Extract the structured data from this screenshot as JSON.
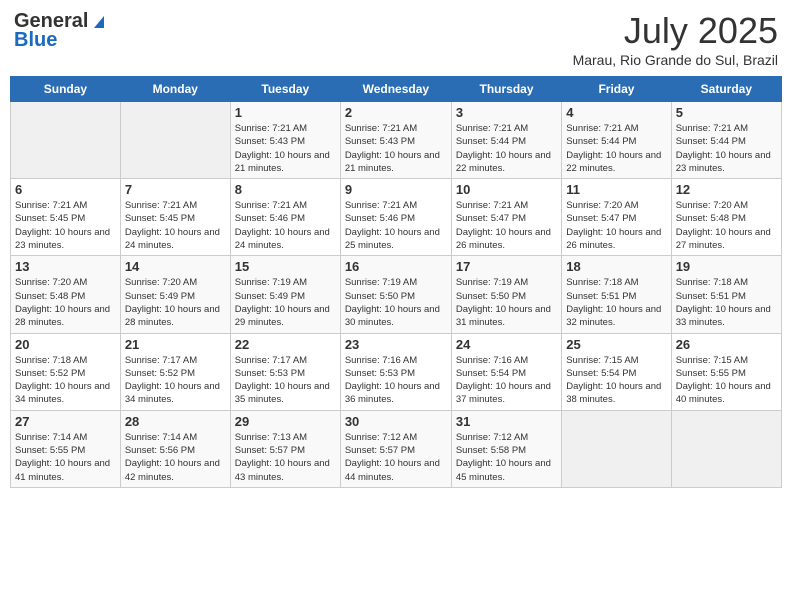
{
  "header": {
    "logo_general": "General",
    "logo_blue": "Blue",
    "title": "July 2025",
    "location": "Marau, Rio Grande do Sul, Brazil"
  },
  "days_of_week": [
    "Sunday",
    "Monday",
    "Tuesday",
    "Wednesday",
    "Thursday",
    "Friday",
    "Saturday"
  ],
  "weeks": [
    [
      {
        "day": "",
        "empty": true
      },
      {
        "day": "",
        "empty": true
      },
      {
        "day": "1",
        "sunrise": "7:21 AM",
        "sunset": "5:43 PM",
        "daylight": "10 hours and 21 minutes."
      },
      {
        "day": "2",
        "sunrise": "7:21 AM",
        "sunset": "5:43 PM",
        "daylight": "10 hours and 21 minutes."
      },
      {
        "day": "3",
        "sunrise": "7:21 AM",
        "sunset": "5:44 PM",
        "daylight": "10 hours and 22 minutes."
      },
      {
        "day": "4",
        "sunrise": "7:21 AM",
        "sunset": "5:44 PM",
        "daylight": "10 hours and 22 minutes."
      },
      {
        "day": "5",
        "sunrise": "7:21 AM",
        "sunset": "5:44 PM",
        "daylight": "10 hours and 23 minutes."
      }
    ],
    [
      {
        "day": "6",
        "sunrise": "7:21 AM",
        "sunset": "5:45 PM",
        "daylight": "10 hours and 23 minutes."
      },
      {
        "day": "7",
        "sunrise": "7:21 AM",
        "sunset": "5:45 PM",
        "daylight": "10 hours and 24 minutes."
      },
      {
        "day": "8",
        "sunrise": "7:21 AM",
        "sunset": "5:46 PM",
        "daylight": "10 hours and 24 minutes."
      },
      {
        "day": "9",
        "sunrise": "7:21 AM",
        "sunset": "5:46 PM",
        "daylight": "10 hours and 25 minutes."
      },
      {
        "day": "10",
        "sunrise": "7:21 AM",
        "sunset": "5:47 PM",
        "daylight": "10 hours and 26 minutes."
      },
      {
        "day": "11",
        "sunrise": "7:20 AM",
        "sunset": "5:47 PM",
        "daylight": "10 hours and 26 minutes."
      },
      {
        "day": "12",
        "sunrise": "7:20 AM",
        "sunset": "5:48 PM",
        "daylight": "10 hours and 27 minutes."
      }
    ],
    [
      {
        "day": "13",
        "sunrise": "7:20 AM",
        "sunset": "5:48 PM",
        "daylight": "10 hours and 28 minutes."
      },
      {
        "day": "14",
        "sunrise": "7:20 AM",
        "sunset": "5:49 PM",
        "daylight": "10 hours and 28 minutes."
      },
      {
        "day": "15",
        "sunrise": "7:19 AM",
        "sunset": "5:49 PM",
        "daylight": "10 hours and 29 minutes."
      },
      {
        "day": "16",
        "sunrise": "7:19 AM",
        "sunset": "5:50 PM",
        "daylight": "10 hours and 30 minutes."
      },
      {
        "day": "17",
        "sunrise": "7:19 AM",
        "sunset": "5:50 PM",
        "daylight": "10 hours and 31 minutes."
      },
      {
        "day": "18",
        "sunrise": "7:18 AM",
        "sunset": "5:51 PM",
        "daylight": "10 hours and 32 minutes."
      },
      {
        "day": "19",
        "sunrise": "7:18 AM",
        "sunset": "5:51 PM",
        "daylight": "10 hours and 33 minutes."
      }
    ],
    [
      {
        "day": "20",
        "sunrise": "7:18 AM",
        "sunset": "5:52 PM",
        "daylight": "10 hours and 34 minutes."
      },
      {
        "day": "21",
        "sunrise": "7:17 AM",
        "sunset": "5:52 PM",
        "daylight": "10 hours and 34 minutes."
      },
      {
        "day": "22",
        "sunrise": "7:17 AM",
        "sunset": "5:53 PM",
        "daylight": "10 hours and 35 minutes."
      },
      {
        "day": "23",
        "sunrise": "7:16 AM",
        "sunset": "5:53 PM",
        "daylight": "10 hours and 36 minutes."
      },
      {
        "day": "24",
        "sunrise": "7:16 AM",
        "sunset": "5:54 PM",
        "daylight": "10 hours and 37 minutes."
      },
      {
        "day": "25",
        "sunrise": "7:15 AM",
        "sunset": "5:54 PM",
        "daylight": "10 hours and 38 minutes."
      },
      {
        "day": "26",
        "sunrise": "7:15 AM",
        "sunset": "5:55 PM",
        "daylight": "10 hours and 40 minutes."
      }
    ],
    [
      {
        "day": "27",
        "sunrise": "7:14 AM",
        "sunset": "5:55 PM",
        "daylight": "10 hours and 41 minutes."
      },
      {
        "day": "28",
        "sunrise": "7:14 AM",
        "sunset": "5:56 PM",
        "daylight": "10 hours and 42 minutes."
      },
      {
        "day": "29",
        "sunrise": "7:13 AM",
        "sunset": "5:57 PM",
        "daylight": "10 hours and 43 minutes."
      },
      {
        "day": "30",
        "sunrise": "7:12 AM",
        "sunset": "5:57 PM",
        "daylight": "10 hours and 44 minutes."
      },
      {
        "day": "31",
        "sunrise": "7:12 AM",
        "sunset": "5:58 PM",
        "daylight": "10 hours and 45 minutes."
      },
      {
        "day": "",
        "empty": true
      },
      {
        "day": "",
        "empty": true
      }
    ]
  ]
}
